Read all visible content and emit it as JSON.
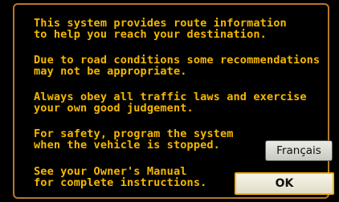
{
  "disclaimer": {
    "paragraph_1": "This system provides route information\nto help you reach your destination.",
    "paragraph_2": "Due to road conditions some recommendations\nmay not be appropriate.",
    "paragraph_3": "Always obey all traffic laws and exercise\nyour own good judgement.",
    "paragraph_4": "For safety, program the system\nwhen the vehicle is stopped.",
    "paragraph_5": "See your Owner's Manual\nfor complete instructions."
  },
  "buttons": {
    "language_label": "Français",
    "ok_label": "OK"
  },
  "colors": {
    "text": "#f5b800",
    "background": "#000000",
    "frame": "#b7782a",
    "button_face": "#d8d8d0"
  }
}
